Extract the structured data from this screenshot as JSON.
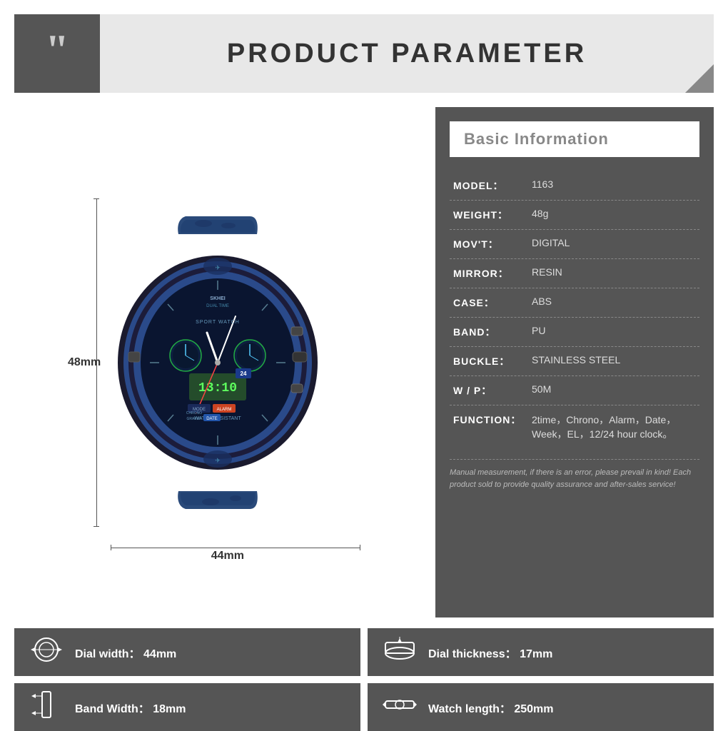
{
  "header": {
    "title": "PRODUCT PARAMETER",
    "quote_char": "““"
  },
  "watch_dimensions": {
    "height_label": "48mm",
    "width_label": "44mm"
  },
  "info_panel": {
    "section_title": "Basic Information",
    "rows": [
      {
        "label": "MODEL：",
        "value": "1163"
      },
      {
        "label": "WEIGHT：",
        "value": "48g"
      },
      {
        "label": "MOV'T：",
        "value": "DIGITAL"
      },
      {
        "label": "MIRROR：",
        "value": "RESIN"
      },
      {
        "label": "CASE：",
        "value": "ABS"
      },
      {
        "label": "BAND：",
        "value": "PU"
      },
      {
        "label": "BUCKLE：",
        "value": "STAINLESS STEEL"
      },
      {
        "label": "W / P：",
        "value": "50M"
      },
      {
        "label": "FUNCTION：",
        "value": "2time，Chrono，Alarm，Date，Week，EL，12/24 hour clock。"
      }
    ],
    "note": "Manual measurement, if there is an error, please prevail in kind!\nEach product sold to provide quality assurance and after-sales service!"
  },
  "bottom_specs": [
    {
      "icon": "⌚",
      "label": "Dial width：",
      "value": "44mm"
    },
    {
      "icon": "▲",
      "label": "Dial thickness：",
      "value": "17mm"
    },
    {
      "icon": "▐",
      "label": "Band Width：",
      "value": "18mm"
    },
    {
      "icon": "⊙",
      "label": "Watch length：",
      "value": "250mm"
    }
  ]
}
